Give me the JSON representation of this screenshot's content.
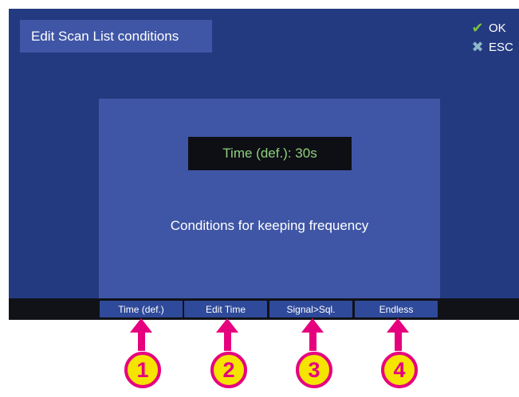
{
  "header": {
    "title": "Edit Scan List conditions"
  },
  "keys": {
    "ok": {
      "label": "OK",
      "icon": "checkmark-icon"
    },
    "esc": {
      "label": "ESC",
      "icon": "cross-icon"
    }
  },
  "panel": {
    "time_display": "Time (def.): 30s",
    "description": "Conditions for keeping frequency"
  },
  "softkeys": [
    {
      "label": "Time (def.)"
    },
    {
      "label": "Edit Time"
    },
    {
      "label": "Signal>Sql."
    },
    {
      "label": "Endless"
    }
  ],
  "callouts": [
    "1",
    "2",
    "3",
    "4"
  ],
  "colors": {
    "screen_bg": "#243a80",
    "panel_bg": "#3f56a6",
    "time_text": "#8ed07d",
    "ok_check": "#7cc241",
    "callout_magenta": "#e6007e",
    "callout_yellow": "#f5e400"
  }
}
